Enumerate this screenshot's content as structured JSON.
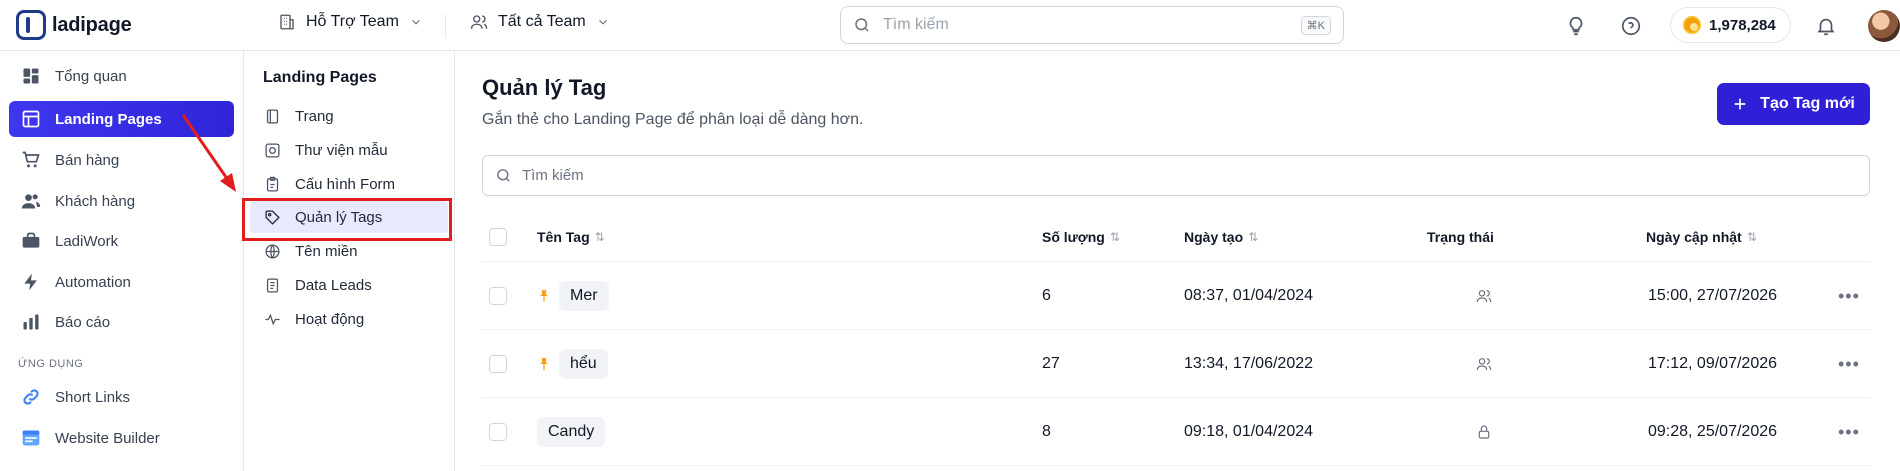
{
  "brand": {
    "name": "ladipage"
  },
  "topbar": {
    "team_select": "Hỗ Trợ Team",
    "team_filter": "Tất cả Team",
    "search_placeholder": "Tìm kiếm",
    "search_shortcut": "⌘K",
    "credits": "1,978,284"
  },
  "sidebar": {
    "items": [
      {
        "label": "Tổng quan",
        "icon": "dashboard-icon"
      },
      {
        "label": "Landing Pages",
        "icon": "layout-icon",
        "active": true
      },
      {
        "label": "Bán hàng",
        "icon": "cart-icon"
      },
      {
        "label": "Khách hàng",
        "icon": "users-icon"
      },
      {
        "label": "LadiWork",
        "icon": "briefcase-icon"
      },
      {
        "label": "Automation",
        "icon": "lightning-icon"
      },
      {
        "label": "Báo cáo",
        "icon": "bar-chart-icon"
      }
    ],
    "section_label": "ỨNG DỤNG",
    "apps": [
      {
        "label": "Short Links",
        "icon": "link-icon"
      },
      {
        "label": "Website Builder",
        "icon": "website-icon"
      }
    ]
  },
  "subnav": {
    "title": "Landing Pages",
    "items": [
      {
        "label": "Trang",
        "icon": "page-icon"
      },
      {
        "label": "Thư viện mẫu",
        "icon": "template-icon"
      },
      {
        "label": "Cấu hình Form",
        "icon": "clipboard-icon"
      },
      {
        "label": "Quản lý Tags",
        "icon": "tag-icon",
        "active": true
      },
      {
        "label": "Tên miền",
        "icon": "globe-icon"
      },
      {
        "label": "Data Leads",
        "icon": "document-icon"
      },
      {
        "label": "Hoạt động",
        "icon": "activity-icon"
      }
    ]
  },
  "main": {
    "title": "Quản lý Tag",
    "subtitle": "Gắn thẻ cho Landing Page để phân loại dễ dàng hơn.",
    "create_button": "Tạo Tag mới",
    "search_placeholder": "Tìm kiếm",
    "columns": {
      "name": "Tên Tag",
      "count": "Số lượng",
      "created": "Ngày tạo",
      "status": "Trạng thái",
      "updated": "Ngày cập nhật"
    },
    "rows": [
      {
        "name": "Mer",
        "pinned": true,
        "count": "6",
        "created": "08:37, 01/04/2024",
        "status": "team-icon",
        "updated": "15:00, 27/07/2026"
      },
      {
        "name": "hểu",
        "pinned": true,
        "count": "27",
        "created": "13:34, 17/06/2022",
        "status": "team-icon",
        "updated": "17:12, 09/07/2026"
      },
      {
        "name": "Candy",
        "pinned": false,
        "count": "8",
        "created": "09:18, 01/04/2024",
        "status": "lock-icon",
        "updated": "09:28, 25/07/2026"
      }
    ]
  },
  "colors": {
    "accent": "#2f1fd6",
    "highlight": "#e11d1d",
    "pin": "#f59e0b"
  }
}
